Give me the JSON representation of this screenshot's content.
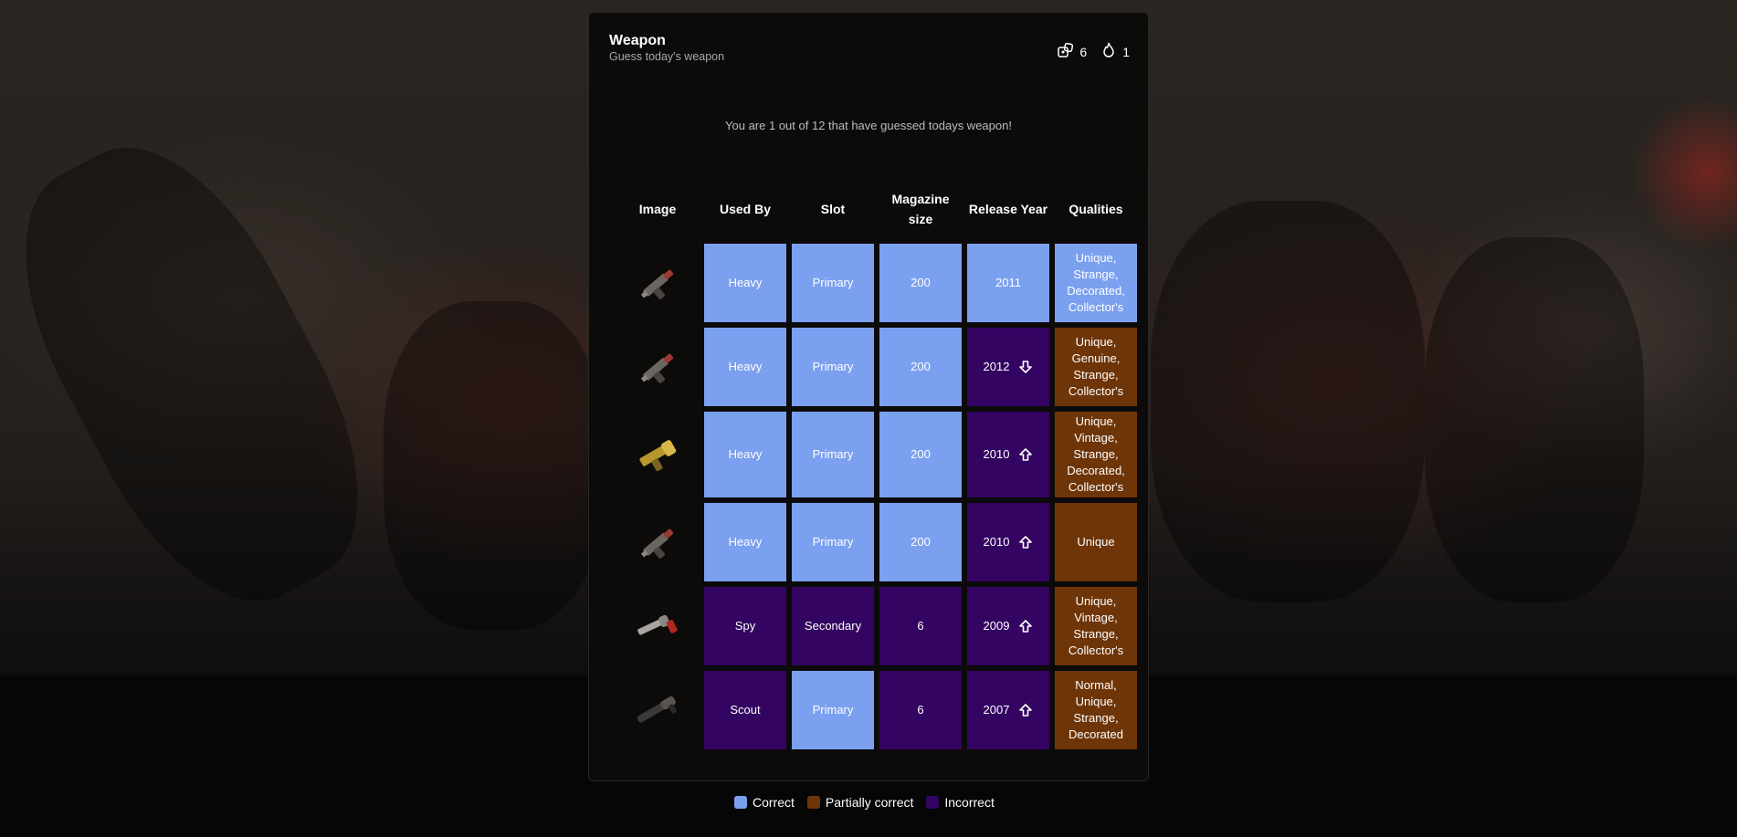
{
  "header": {
    "title": "Weapon",
    "subtitle": "Guess today's weapon"
  },
  "stats": {
    "guesses": "6",
    "streak": "1"
  },
  "notice": "You are 1 out of 12 that have guessed todays weapon!",
  "columns": [
    "Image",
    "Used By",
    "Slot",
    "Magazine size",
    "Release Year",
    "Qualities"
  ],
  "rows": [
    {
      "used_by": "Heavy",
      "used_by_s": "correct",
      "slot": "Primary",
      "slot_s": "correct",
      "mag": "200",
      "mag_s": "correct",
      "year": "2011",
      "year_s": "correct",
      "arrow": "",
      "qualities": "Unique, Strange, Decorated, Collector's",
      "qualities_s": "correct",
      "icon": "minigun-weapon-icon"
    },
    {
      "used_by": "Heavy",
      "used_by_s": "correct",
      "slot": "Primary",
      "slot_s": "correct",
      "mag": "200",
      "mag_s": "correct",
      "year": "2012",
      "year_s": "incorrect",
      "arrow": "down",
      "qualities": "Unique, Genuine, Strange, Collector's",
      "qualities_s": "partial",
      "icon": "minigun-weapon-icon"
    },
    {
      "used_by": "Heavy",
      "used_by_s": "correct",
      "slot": "Primary",
      "slot_s": "correct",
      "mag": "200",
      "mag_s": "correct",
      "year": "2010",
      "year_s": "incorrect",
      "arrow": "up",
      "qualities": "Unique, Vintage, Strange, Decorated, Collector's",
      "qualities_s": "partial",
      "icon": "gold-minigun-weapon-icon"
    },
    {
      "used_by": "Heavy",
      "used_by_s": "correct",
      "slot": "Primary",
      "slot_s": "correct",
      "mag": "200",
      "mag_s": "correct",
      "year": "2010",
      "year_s": "incorrect",
      "arrow": "up",
      "qualities": "Unique",
      "qualities_s": "partial",
      "icon": "minigun-weapon-icon"
    },
    {
      "used_by": "Spy",
      "used_by_s": "incorrect",
      "slot": "Secondary",
      "slot_s": "incorrect",
      "mag": "6",
      "mag_s": "incorrect",
      "year": "2009",
      "year_s": "incorrect",
      "arrow": "up",
      "qualities": "Unique, Vintage, Strange, Collector's",
      "qualities_s": "partial",
      "icon": "revolver-weapon-icon"
    },
    {
      "used_by": "Scout",
      "used_by_s": "incorrect",
      "slot": "Primary",
      "slot_s": "correct",
      "mag": "6",
      "mag_s": "incorrect",
      "year": "2007",
      "year_s": "incorrect",
      "arrow": "up",
      "qualities": "Normal, Unique, Strange, Decorated",
      "qualities_s": "partial",
      "icon": "scattergun-weapon-icon"
    }
  ],
  "legend": {
    "correct": "Correct",
    "partial": "Partially correct",
    "incorrect": "Incorrect"
  },
  "colors": {
    "correct": "#7ba0ef",
    "partial": "#6e3508",
    "incorrect": "#330461"
  }
}
